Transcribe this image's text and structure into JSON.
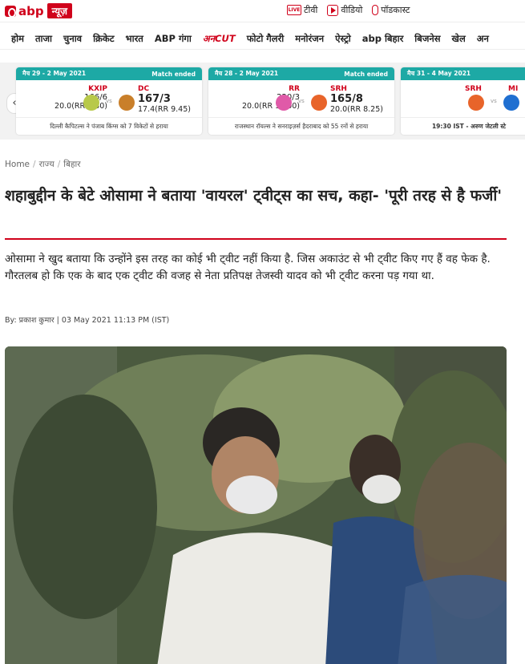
{
  "header": {
    "logo_text": "abp",
    "logo_news": "न्यूज़",
    "links": [
      {
        "icon": "live-tv-icon",
        "icon_text": "LIVE",
        "label": "टीवी"
      },
      {
        "icon": "video-play-icon",
        "label": "वीडियो"
      },
      {
        "icon": "microphone-icon",
        "label": "पॉडकास्ट"
      }
    ]
  },
  "nav": [
    "होम",
    "ताजा",
    "चुनाव",
    "क्रिकेट",
    "भारत",
    "ABP गंगा",
    "अनCUT",
    "फोटो गैलरी",
    "मनोरंजन",
    "ऐस्ट्रो",
    "abp बिहार",
    "बिजनेस",
    "खेल",
    "अन"
  ],
  "scores": {
    "prev_arrow": "‹",
    "vs_text": "vs",
    "cards": [
      {
        "match": "मैच 29 - 2 May 2021",
        "status": "Match ended",
        "team1": {
          "name": "KXIP",
          "score": "166/6",
          "overs": "20.0(RR 8.30)"
        },
        "team2": {
          "name": "DC",
          "score": "167/3",
          "overs": "17.4(RR 9.45)"
        },
        "result": "दिल्ली कैपिटल्स ने पंजाब किंग्स को 7 विकेटों से हराया"
      },
      {
        "match": "मैच 28 - 2 May 2021",
        "status": "Match ended",
        "team1": {
          "name": "RR",
          "score": "220/3",
          "overs": "20.0(RR 11.00)"
        },
        "team2": {
          "name": "SRH",
          "score": "165/8",
          "overs": "20.0(RR 8.25)"
        },
        "result": "राजस्थान रॉयल्स ने सनराइज़र्स हैदराबाद को 55 रनों से हराया"
      },
      {
        "match": "मैच 31 - 4 May 2021",
        "status": "",
        "team1": {
          "name": "SRH",
          "score": "",
          "overs": ""
        },
        "team2": {
          "name": "MI",
          "score": "",
          "overs": ""
        },
        "result": "19:30 IST - अरुण जेटली स्टे"
      }
    ]
  },
  "article": {
    "breadcrumb": [
      "Home",
      "राज्य",
      "बिहार"
    ],
    "headline": "शहाबुद्दीन के बेटे ओसामा ने बताया 'वायरल' ट्वीट्स का सच, कहा- 'पूरी तरह से है फर्जी'",
    "summary": "ओसामा ने खुद बताया कि उन्होंने इस तरह का कोई भी ट्वीट नहीं किया है. जिस अकाउंट से भी ट्वीट किए गए हैं वह फेक है. गौरतलब हो कि एक के बाद एक ट्वीट की वजह से नेता प्रतिपक्ष तेजस्वी यादव को भी ट्वीट करना पड़ गया था.",
    "byline": "By: प्रकाश कुमार | 03 May 2021 11:13 PM (IST)"
  },
  "colors": {
    "brand": "#d0021b",
    "card_header": "#1da9a5"
  }
}
